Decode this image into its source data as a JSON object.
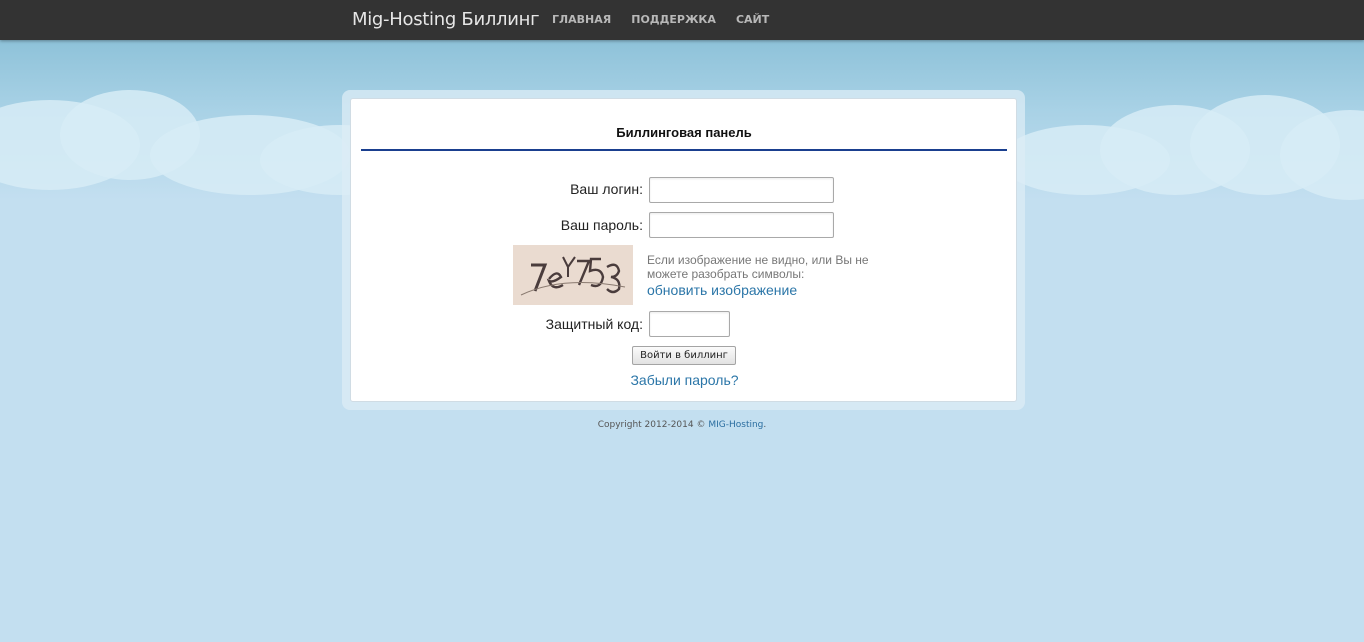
{
  "navbar": {
    "brand": "Mig-Hosting Биллинг",
    "links": [
      "ГЛАВНАЯ",
      "ПОДДЕРЖКА",
      "САЙТ"
    ]
  },
  "panel": {
    "title": "Биллинговая панель",
    "login_label": "Ваш логин:",
    "login_value": "",
    "password_label": "Ваш пароль:",
    "password_value": "",
    "captcha_text": "7eY753",
    "captcha_hint": "Если изображение не видно, или Вы не можете разобрать символы:",
    "captcha_refresh": "обновить изображение",
    "code_label": "Защитный код:",
    "code_value": "",
    "submit_label": "Войти в биллинг",
    "forgot_link": "Забыли пароль?"
  },
  "footer": {
    "copyright": "Copyright 2012-2014 © ",
    "company_link": "MIG-Hosting",
    "suffix": "."
  },
  "colors": {
    "navbar_bg": "#333333",
    "panel_rule": "#1a3f8f",
    "link": "#2b76a8",
    "sky": "#c3dff0"
  }
}
